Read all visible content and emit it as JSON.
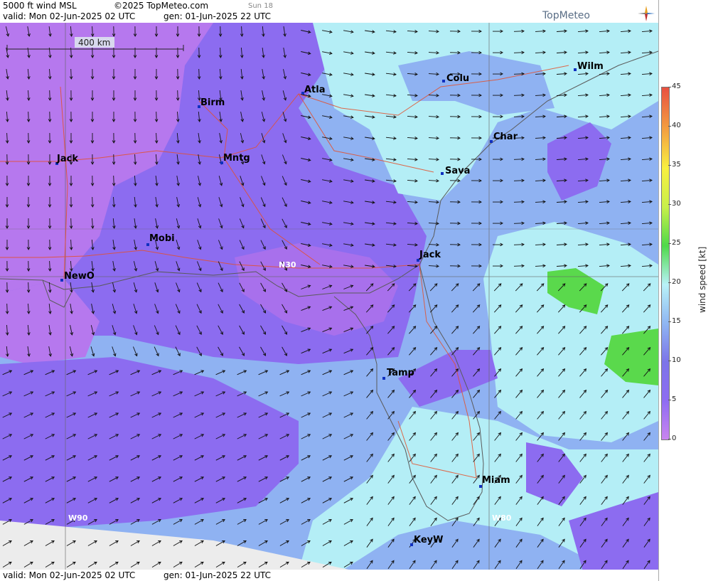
{
  "header": {
    "product": "5000 ft wind MSL",
    "copyright": "©2025 TopMeteo.com",
    "day_label": "Sun 18",
    "valid": "valid:  Mon  02-Jun-2025  02 UTC",
    "gen": "gen: 01-Jun-2025 22 UTC",
    "logo": "TopMeteo"
  },
  "footer": {
    "valid": "valid:  Mon  02-Jun-2025  02 UTC",
    "gen": "gen: 01-Jun-2025 22 UTC"
  },
  "map": {
    "scale_label": "400 km",
    "grid_labels": [
      "N30",
      "W90",
      "W80"
    ],
    "cities": [
      "Colu",
      "Wilm",
      "Birm",
      "Atla",
      "Char",
      "Jack",
      "Mntg",
      "Sava",
      "Mobi",
      "Jack",
      "NewO",
      "Tamp",
      "Miam",
      "KeyW"
    ],
    "colors": {
      "calm_purple": "#b678ee",
      "light_purple": "#8c6cf0",
      "light_blue": "#8fb2f2",
      "cyan": "#b4eef6",
      "green": "#5ad94c"
    }
  },
  "legend": {
    "title": "wind speed [kt]",
    "ticks": [
      "45",
      "40",
      "35",
      "30",
      "25",
      "20",
      "15",
      "10",
      "5",
      "0"
    ],
    "range": [
      0,
      45
    ],
    "colors": [
      "#c984f0",
      "#8e6cf2",
      "#7c74e8",
      "#8fb6f2",
      "#b8f2f8",
      "#4fd94a",
      "#c8f04a",
      "#f8f040",
      "#f4a040",
      "#e85040"
    ]
  }
}
